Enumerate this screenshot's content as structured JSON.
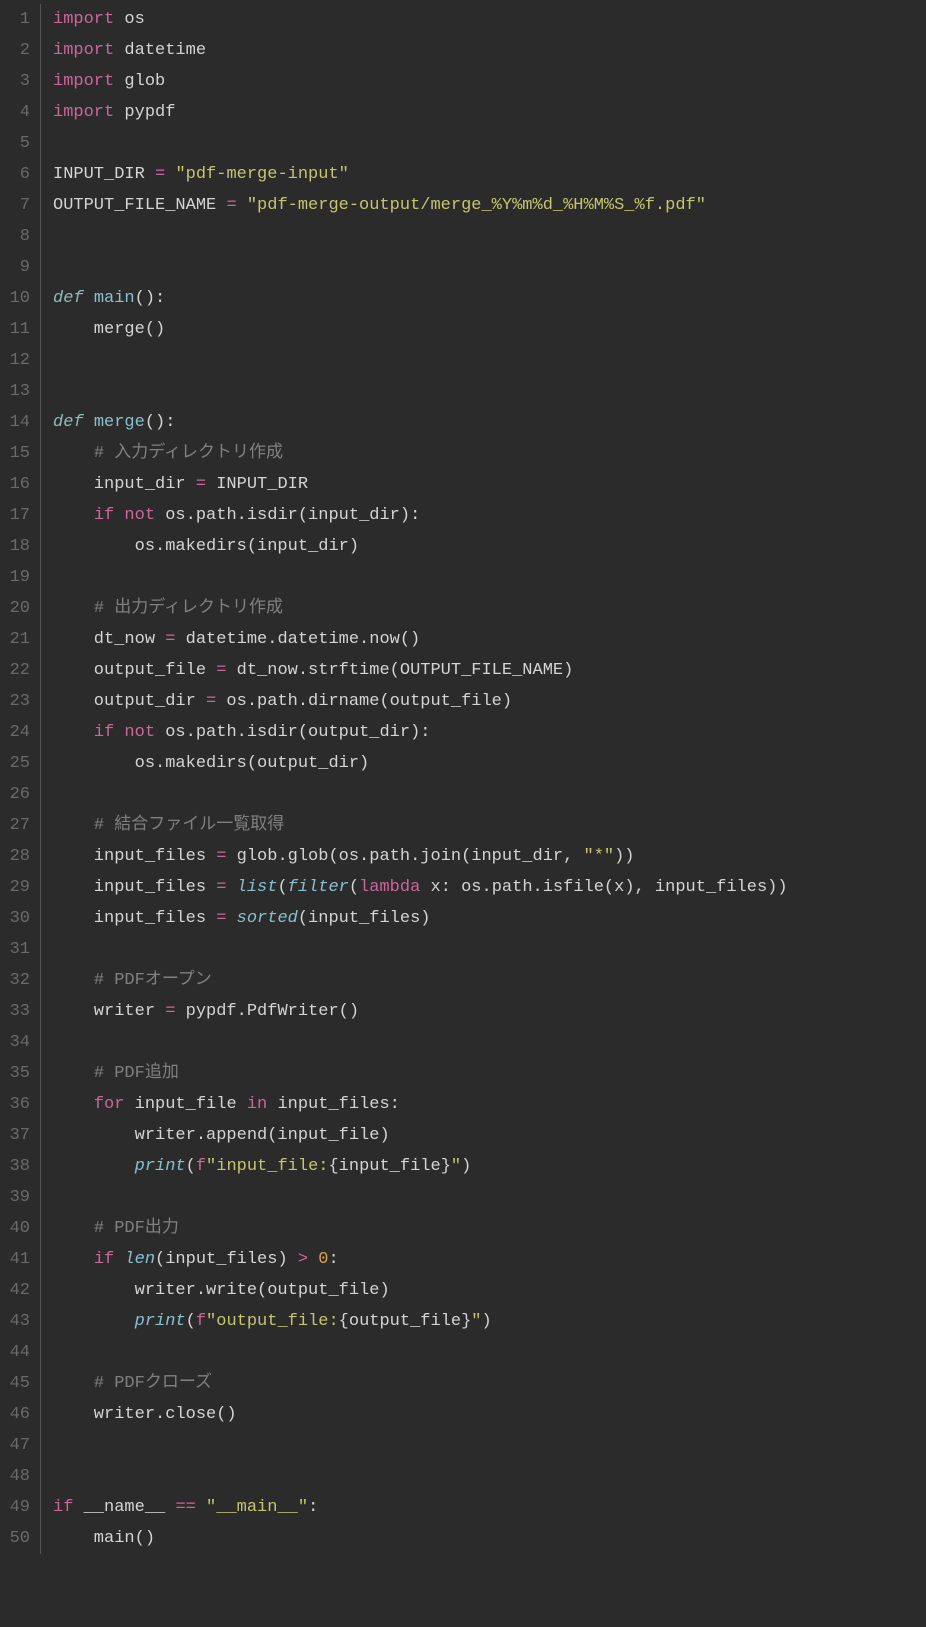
{
  "lines": [
    {
      "num": "1",
      "tokens": [
        {
          "c": "kw",
          "t": "import"
        },
        {
          "c": "id",
          "t": " os"
        }
      ]
    },
    {
      "num": "2",
      "tokens": [
        {
          "c": "kw",
          "t": "import"
        },
        {
          "c": "id",
          "t": " datetime"
        }
      ]
    },
    {
      "num": "3",
      "tokens": [
        {
          "c": "kw",
          "t": "import"
        },
        {
          "c": "id",
          "t": " glob"
        }
      ]
    },
    {
      "num": "4",
      "tokens": [
        {
          "c": "kw",
          "t": "import"
        },
        {
          "c": "id",
          "t": " pypdf"
        }
      ]
    },
    {
      "num": "5",
      "tokens": []
    },
    {
      "num": "6",
      "tokens": [
        {
          "c": "id",
          "t": "INPUT_DIR "
        },
        {
          "c": "op",
          "t": "="
        },
        {
          "c": "id",
          "t": " "
        },
        {
          "c": "str",
          "t": "\"pdf-merge-input\""
        }
      ]
    },
    {
      "num": "7",
      "tokens": [
        {
          "c": "id",
          "t": "OUTPUT_FILE_NAME "
        },
        {
          "c": "op",
          "t": "="
        },
        {
          "c": "id",
          "t": " "
        },
        {
          "c": "str",
          "t": "\"pdf-merge-output/merge_%Y%m%d_%H%M%S_%f.pdf\""
        }
      ]
    },
    {
      "num": "8",
      "tokens": []
    },
    {
      "num": "9",
      "tokens": []
    },
    {
      "num": "10",
      "tokens": [
        {
          "c": "def",
          "t": "def"
        },
        {
          "c": "id",
          "t": " "
        },
        {
          "c": "fn",
          "t": "main"
        },
        {
          "c": "punct",
          "t": "():"
        }
      ]
    },
    {
      "num": "11",
      "tokens": [
        {
          "c": "id",
          "t": "    merge()"
        }
      ]
    },
    {
      "num": "12",
      "tokens": []
    },
    {
      "num": "13",
      "tokens": []
    },
    {
      "num": "14",
      "tokens": [
        {
          "c": "def",
          "t": "def"
        },
        {
          "c": "id",
          "t": " "
        },
        {
          "c": "fn",
          "t": "merge"
        },
        {
          "c": "punct",
          "t": "():"
        }
      ]
    },
    {
      "num": "15",
      "tokens": [
        {
          "c": "id",
          "t": "    "
        },
        {
          "c": "cmt",
          "t": "# 入力ディレクトリ作成"
        }
      ]
    },
    {
      "num": "16",
      "tokens": [
        {
          "c": "id",
          "t": "    input_dir "
        },
        {
          "c": "op",
          "t": "="
        },
        {
          "c": "id",
          "t": " INPUT_DIR"
        }
      ]
    },
    {
      "num": "17",
      "tokens": [
        {
          "c": "id",
          "t": "    "
        },
        {
          "c": "kw",
          "t": "if"
        },
        {
          "c": "id",
          "t": " "
        },
        {
          "c": "kw",
          "t": "not"
        },
        {
          "c": "id",
          "t": " os.path.isdir(input_dir):"
        }
      ]
    },
    {
      "num": "18",
      "tokens": [
        {
          "c": "id",
          "t": "        os.makedirs(input_dir)"
        }
      ]
    },
    {
      "num": "19",
      "tokens": []
    },
    {
      "num": "20",
      "tokens": [
        {
          "c": "id",
          "t": "    "
        },
        {
          "c": "cmt",
          "t": "# 出力ディレクトリ作成"
        }
      ]
    },
    {
      "num": "21",
      "tokens": [
        {
          "c": "id",
          "t": "    dt_now "
        },
        {
          "c": "op",
          "t": "="
        },
        {
          "c": "id",
          "t": " datetime.datetime.now()"
        }
      ]
    },
    {
      "num": "22",
      "tokens": [
        {
          "c": "id",
          "t": "    output_file "
        },
        {
          "c": "op",
          "t": "="
        },
        {
          "c": "id",
          "t": " dt_now.strftime(OUTPUT_FILE_NAME)"
        }
      ]
    },
    {
      "num": "23",
      "tokens": [
        {
          "c": "id",
          "t": "    output_dir "
        },
        {
          "c": "op",
          "t": "="
        },
        {
          "c": "id",
          "t": " os.path.dirname(output_file)"
        }
      ]
    },
    {
      "num": "24",
      "tokens": [
        {
          "c": "id",
          "t": "    "
        },
        {
          "c": "kw",
          "t": "if"
        },
        {
          "c": "id",
          "t": " "
        },
        {
          "c": "kw",
          "t": "not"
        },
        {
          "c": "id",
          "t": " os.path.isdir(output_dir):"
        }
      ]
    },
    {
      "num": "25",
      "tokens": [
        {
          "c": "id",
          "t": "        os.makedirs(output_dir)"
        }
      ]
    },
    {
      "num": "26",
      "tokens": []
    },
    {
      "num": "27",
      "tokens": [
        {
          "c": "id",
          "t": "    "
        },
        {
          "c": "cmt",
          "t": "# 結合ファイル一覧取得"
        }
      ]
    },
    {
      "num": "28",
      "tokens": [
        {
          "c": "id",
          "t": "    input_files "
        },
        {
          "c": "op",
          "t": "="
        },
        {
          "c": "id",
          "t": " glob.glob(os.path.join(input_dir, "
        },
        {
          "c": "str",
          "t": "\"*\""
        },
        {
          "c": "id",
          "t": "))"
        }
      ]
    },
    {
      "num": "29",
      "tokens": [
        {
          "c": "id",
          "t": "    input_files "
        },
        {
          "c": "op",
          "t": "="
        },
        {
          "c": "id",
          "t": " "
        },
        {
          "c": "builtin",
          "t": "list"
        },
        {
          "c": "id",
          "t": "("
        },
        {
          "c": "builtin",
          "t": "filter"
        },
        {
          "c": "id",
          "t": "("
        },
        {
          "c": "kw",
          "t": "lambda"
        },
        {
          "c": "id",
          "t": " x: os.path.isfile(x), input_files))"
        }
      ]
    },
    {
      "num": "30",
      "tokens": [
        {
          "c": "id",
          "t": "    input_files "
        },
        {
          "c": "op",
          "t": "="
        },
        {
          "c": "id",
          "t": " "
        },
        {
          "c": "builtin",
          "t": "sorted"
        },
        {
          "c": "id",
          "t": "(input_files)"
        }
      ]
    },
    {
      "num": "31",
      "tokens": []
    },
    {
      "num": "32",
      "tokens": [
        {
          "c": "id",
          "t": "    "
        },
        {
          "c": "cmt",
          "t": "# PDFオープン"
        }
      ]
    },
    {
      "num": "33",
      "tokens": [
        {
          "c": "id",
          "t": "    writer "
        },
        {
          "c": "op",
          "t": "="
        },
        {
          "c": "id",
          "t": " pypdf.PdfWriter()"
        }
      ]
    },
    {
      "num": "34",
      "tokens": []
    },
    {
      "num": "35",
      "tokens": [
        {
          "c": "id",
          "t": "    "
        },
        {
          "c": "cmt",
          "t": "# PDF追加"
        }
      ]
    },
    {
      "num": "36",
      "tokens": [
        {
          "c": "id",
          "t": "    "
        },
        {
          "c": "kw",
          "t": "for"
        },
        {
          "c": "id",
          "t": " input_file "
        },
        {
          "c": "kw",
          "t": "in"
        },
        {
          "c": "id",
          "t": " input_files:"
        }
      ]
    },
    {
      "num": "37",
      "tokens": [
        {
          "c": "id",
          "t": "        writer.append(input_file)"
        }
      ]
    },
    {
      "num": "38",
      "tokens": [
        {
          "c": "id",
          "t": "        "
        },
        {
          "c": "builtin",
          "t": "print"
        },
        {
          "c": "id",
          "t": "("
        },
        {
          "c": "kw",
          "t": "f"
        },
        {
          "c": "str",
          "t": "\"input_file:"
        },
        {
          "c": "punct",
          "t": "{"
        },
        {
          "c": "id",
          "t": "input_file"
        },
        {
          "c": "punct",
          "t": "}"
        },
        {
          "c": "str",
          "t": "\""
        },
        {
          "c": "id",
          "t": ")"
        }
      ]
    },
    {
      "num": "39",
      "tokens": []
    },
    {
      "num": "40",
      "tokens": [
        {
          "c": "id",
          "t": "    "
        },
        {
          "c": "cmt",
          "t": "# PDF出力"
        }
      ]
    },
    {
      "num": "41",
      "tokens": [
        {
          "c": "id",
          "t": "    "
        },
        {
          "c": "kw",
          "t": "if"
        },
        {
          "c": "id",
          "t": " "
        },
        {
          "c": "builtin",
          "t": "len"
        },
        {
          "c": "id",
          "t": "(input_files) "
        },
        {
          "c": "op",
          "t": ">"
        },
        {
          "c": "id",
          "t": " "
        },
        {
          "c": "num",
          "t": "0"
        },
        {
          "c": "id",
          "t": ":"
        }
      ]
    },
    {
      "num": "42",
      "tokens": [
        {
          "c": "id",
          "t": "        writer.write(output_file)"
        }
      ]
    },
    {
      "num": "43",
      "tokens": [
        {
          "c": "id",
          "t": "        "
        },
        {
          "c": "builtin",
          "t": "print"
        },
        {
          "c": "id",
          "t": "("
        },
        {
          "c": "kw",
          "t": "f"
        },
        {
          "c": "str",
          "t": "\"output_file:"
        },
        {
          "c": "punct",
          "t": "{"
        },
        {
          "c": "id",
          "t": "output_file"
        },
        {
          "c": "punct",
          "t": "}"
        },
        {
          "c": "str",
          "t": "\""
        },
        {
          "c": "id",
          "t": ")"
        }
      ]
    },
    {
      "num": "44",
      "tokens": []
    },
    {
      "num": "45",
      "tokens": [
        {
          "c": "id",
          "t": "    "
        },
        {
          "c": "cmt",
          "t": "# PDFクローズ"
        }
      ]
    },
    {
      "num": "46",
      "tokens": [
        {
          "c": "id",
          "t": "    writer.close()"
        }
      ]
    },
    {
      "num": "47",
      "tokens": []
    },
    {
      "num": "48",
      "tokens": []
    },
    {
      "num": "49",
      "tokens": [
        {
          "c": "kw",
          "t": "if"
        },
        {
          "c": "id",
          "t": " __name__ "
        },
        {
          "c": "op",
          "t": "=="
        },
        {
          "c": "id",
          "t": " "
        },
        {
          "c": "str",
          "t": "\"__main__\""
        },
        {
          "c": "id",
          "t": ":"
        }
      ]
    },
    {
      "num": "50",
      "tokens": [
        {
          "c": "id",
          "t": "    main()"
        }
      ]
    }
  ]
}
